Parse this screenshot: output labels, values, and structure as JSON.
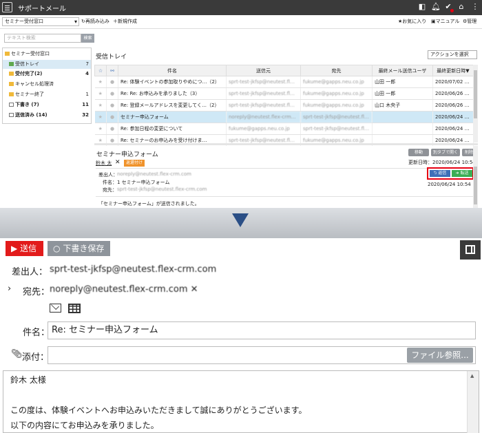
{
  "app": {
    "title": "サポートメール"
  },
  "toolbar": {
    "mailbox": "セミナー受付窓口",
    "reload": "再読み込み",
    "new_mail": "新規作成",
    "favorites": "お気に入り",
    "manual": "マニュアル",
    "admin": "管理"
  },
  "search": {
    "placeholder": "テキスト検索",
    "button": "検索"
  },
  "sidebar": {
    "root": "セミナー受付窓口",
    "items": [
      {
        "label": "受信トレイ",
        "count": "7"
      },
      {
        "label": "受付完了(2)",
        "count": "4"
      },
      {
        "label": "キャンセル処理済",
        "count": ""
      },
      {
        "label": "セミナー終了",
        "count": "1"
      },
      {
        "label": "下書き (7)",
        "count": "11"
      },
      {
        "label": "送信済み (14)",
        "count": "32"
      }
    ]
  },
  "list": {
    "title": "受信トレイ",
    "action": "アクションを選択",
    "headers": [
      "件名",
      "送信元",
      "宛先",
      "最終メール送信ユーザ",
      "最終更新日時▼"
    ],
    "rows": [
      {
        "subject": "Re: 体験イベントの参加取りやめにつ…（2）",
        "from": "sprt-test-jkfsp@neutest.fl…",
        "to": "fukume@gapps.neu.co.jp",
        "user": "山田 一郎",
        "date": "2020/07/02 …"
      },
      {
        "subject": "Re: Re: お申込みを承りました（3）",
        "from": "sprt-test-jkfsp@neutest.fl…",
        "to": "fukume@gapps.neu.co.jp",
        "user": "山田 一郎",
        "date": "2020/06/26 …"
      },
      {
        "subject": "Re: 登録メールアドレスを変更してく…（2）",
        "from": "sprt-test-jkfsp@neutest.fl…",
        "to": "fukume@gapps.neu.co.jp",
        "user": "山口 木央子",
        "date": "2020/06/26 …"
      },
      {
        "subject": "セミナー申込フォーム",
        "from": "noreply@neutest.flex-crm…",
        "to": "sprt-test-jkfsp@neutest.fl…",
        "user": "",
        "date": "2020/06/24 …"
      },
      {
        "subject": "Re: 参加日程の変更について",
        "from": "fukume@gapps.neu.co.jp",
        "to": "sprt-test-jkfsp@neutest.fl…",
        "user": "",
        "date": "2020/06/24 …"
      },
      {
        "subject": "Re: セミナーのお申込みを受け付けま…",
        "from": "sprt-test-jkfsp@neutest.fl…",
        "to": "fukume@gapps.neu.co.jp",
        "user": "",
        "date": "2020/06/24 …"
      }
    ]
  },
  "preview": {
    "subject": "セミナー申込フォーム",
    "person": "鈴木 太",
    "tag": "返還付け",
    "move": "移動",
    "new_tab": "別タブで開く",
    "delete": "削除",
    "updated": "更新日時：2020/06/24 10:54",
    "from_label": "差出人：",
    "from": "noreply@neutest.flex-crm.com",
    "subj_label": "件名：",
    "subj": "1  セミナー申込フォーム",
    "to_label": "宛先：",
    "to": "sprt-test-jkfsp@neutest.flex-crm.com",
    "reply": "返信",
    "forward": "転送",
    "date": "2020/06/24 10:54",
    "body": "「セミナー申込フォーム」が送信されました。"
  },
  "compose": {
    "send": "送信",
    "draft": "下書き保存",
    "from_label": "差出人：",
    "from": "sprt-test-jkfsp@neutest.flex-crm.com",
    "to_label": "宛先：",
    "to": "noreply@neutest.flex-crm.com ✕",
    "subject_label": "件名：",
    "subject": "Re: セミナー申込フォーム",
    "attach_label": "添付：",
    "file_button": "ファイル参照...",
    "body": [
      "鈴木 太様",
      "",
      "この度は、体験イベントへお申込みいただきまして誠にありがとうございます。",
      "以下の内容にてお申込みを承りました。"
    ]
  }
}
